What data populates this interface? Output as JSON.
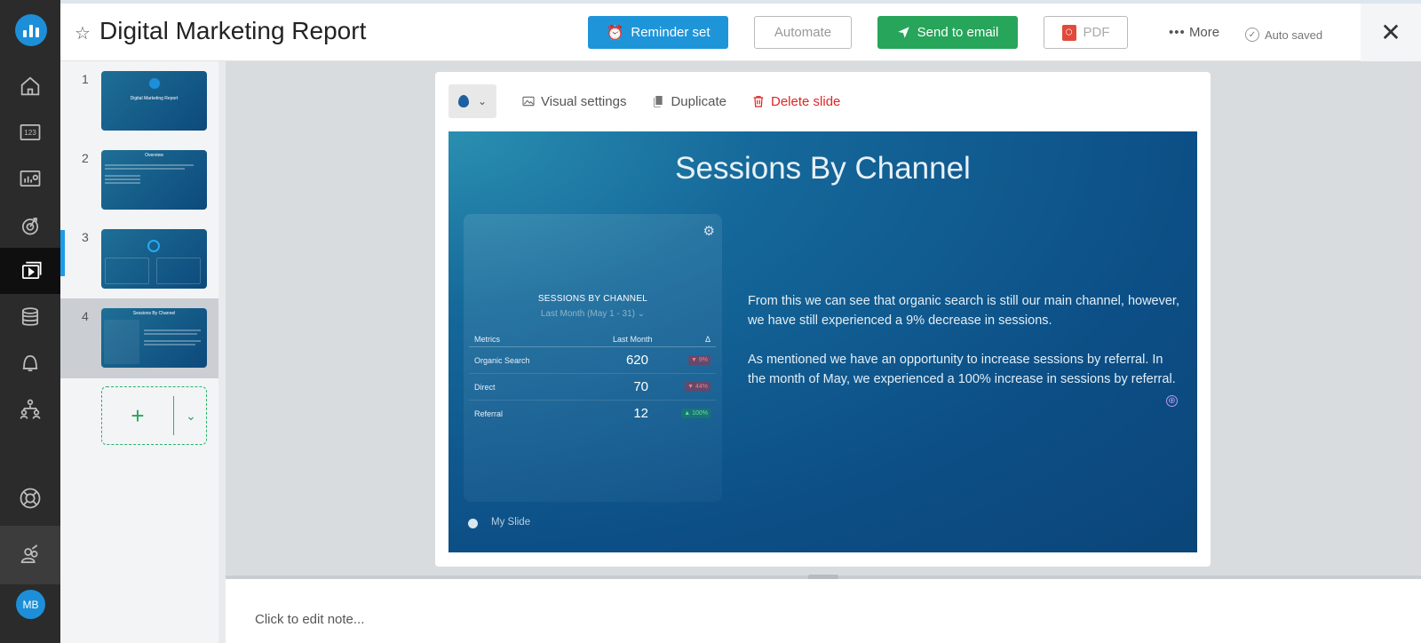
{
  "header": {
    "title": "Digital Marketing Report",
    "buttons": {
      "reminder": "Reminder set",
      "automate": "Automate",
      "email": "Send to email",
      "pdf": "PDF",
      "more": "More"
    },
    "autosaved": "Auto saved"
  },
  "nav": {
    "icons": [
      "home-icon",
      "numbers-icon",
      "dashboard-icon",
      "goals-icon",
      "slides-icon",
      "database-icon",
      "alerts-icon",
      "team-icon",
      "help-icon",
      "users-icon"
    ],
    "avatar": "MB"
  },
  "thumbnails": [
    {
      "num": "1",
      "title": "Digital Marketing Report"
    },
    {
      "num": "2",
      "title": "Overview"
    },
    {
      "num": "3",
      "title": ""
    },
    {
      "num": "4",
      "title": "Sessions By Channel"
    }
  ],
  "slide_toolbar": {
    "visual_settings": "Visual settings",
    "duplicate": "Duplicate",
    "delete": "Delete slide"
  },
  "slide": {
    "title": "Sessions By Channel",
    "widget": {
      "title": "SESSIONS BY CHANNEL",
      "subtitle": "Last Month (May 1 - 31) ⌄",
      "headers": {
        "metrics": "Metrics",
        "period": "Last Month",
        "delta": "Δ"
      },
      "rows": [
        {
          "label": "Organic Search",
          "value": "620",
          "change": "▼ 9%",
          "dir": "down"
        },
        {
          "label": "Direct",
          "value": "70",
          "change": "▼ 44%",
          "dir": "down"
        },
        {
          "label": "Referral",
          "value": "12",
          "change": "▲ 100%",
          "dir": "up"
        }
      ]
    },
    "text": {
      "p1": "From this we can see that organic search is still our main channel, however, we have still experienced a 9% decrease in sessions.",
      "p2": "As mentioned we have an opportunity to increase sessions by referral. In the month of May, we experienced a 100% increase in sessions by referral."
    },
    "footer": "My Slide"
  },
  "notes": {
    "placeholder": "Click to edit note..."
  },
  "colors": {
    "accent_blue": "#1f95d9",
    "green": "#27a55a",
    "delete_red": "#e02424"
  }
}
